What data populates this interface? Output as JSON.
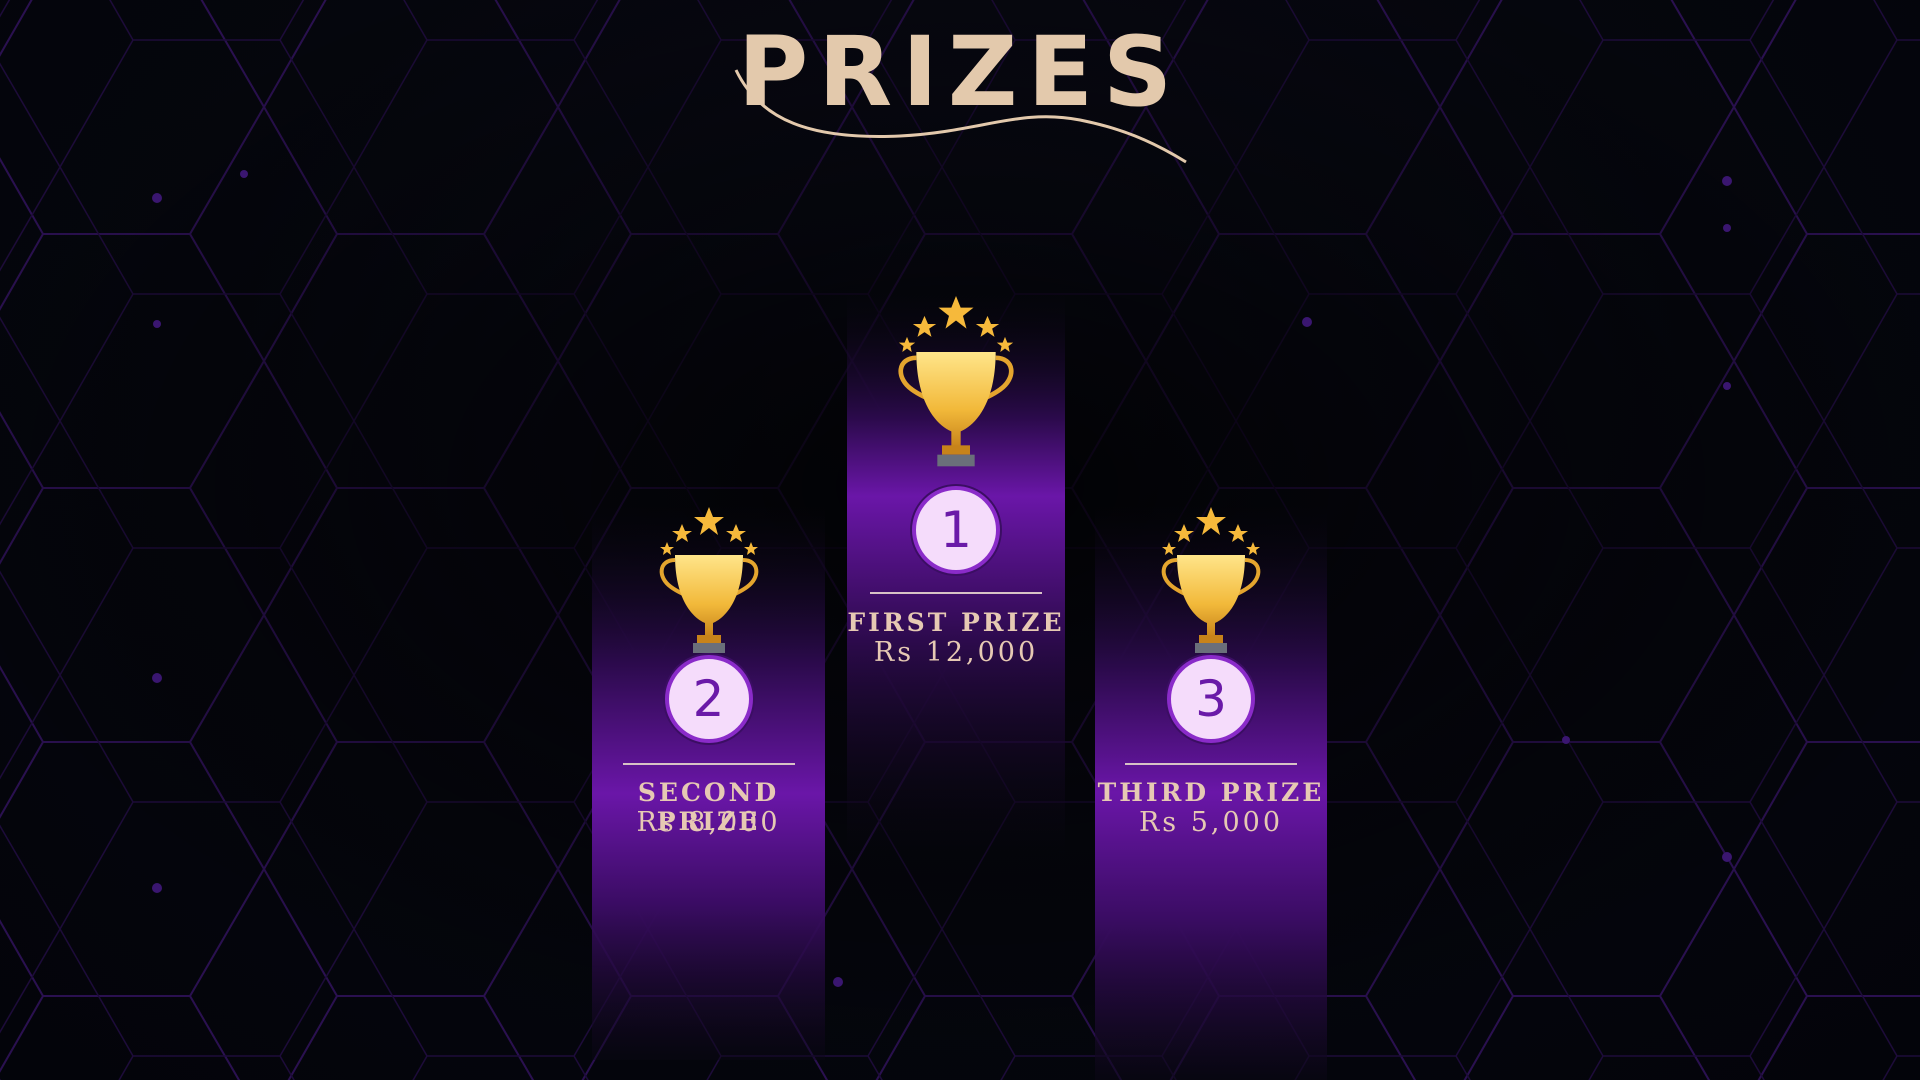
{
  "title": "PRIZES",
  "colors": {
    "background": "#05060d",
    "accent_purple": "#6a16a8",
    "text_gold": "#e6c9b3",
    "trophy_gold": "#f2b93a",
    "medal_fill": "#f5dcfb"
  },
  "prizes": [
    {
      "rank": "1",
      "label": "FIRST PRIZE",
      "amount": "Rs 12,000",
      "icon": "trophy-icon"
    },
    {
      "rank": "2",
      "label": "SECOND PRIZE",
      "amount": "Rs 8,000",
      "icon": "trophy-icon"
    },
    {
      "rank": "3",
      "label": "THIRD PRIZE",
      "amount": "Rs 5,000",
      "icon": "trophy-icon"
    }
  ]
}
